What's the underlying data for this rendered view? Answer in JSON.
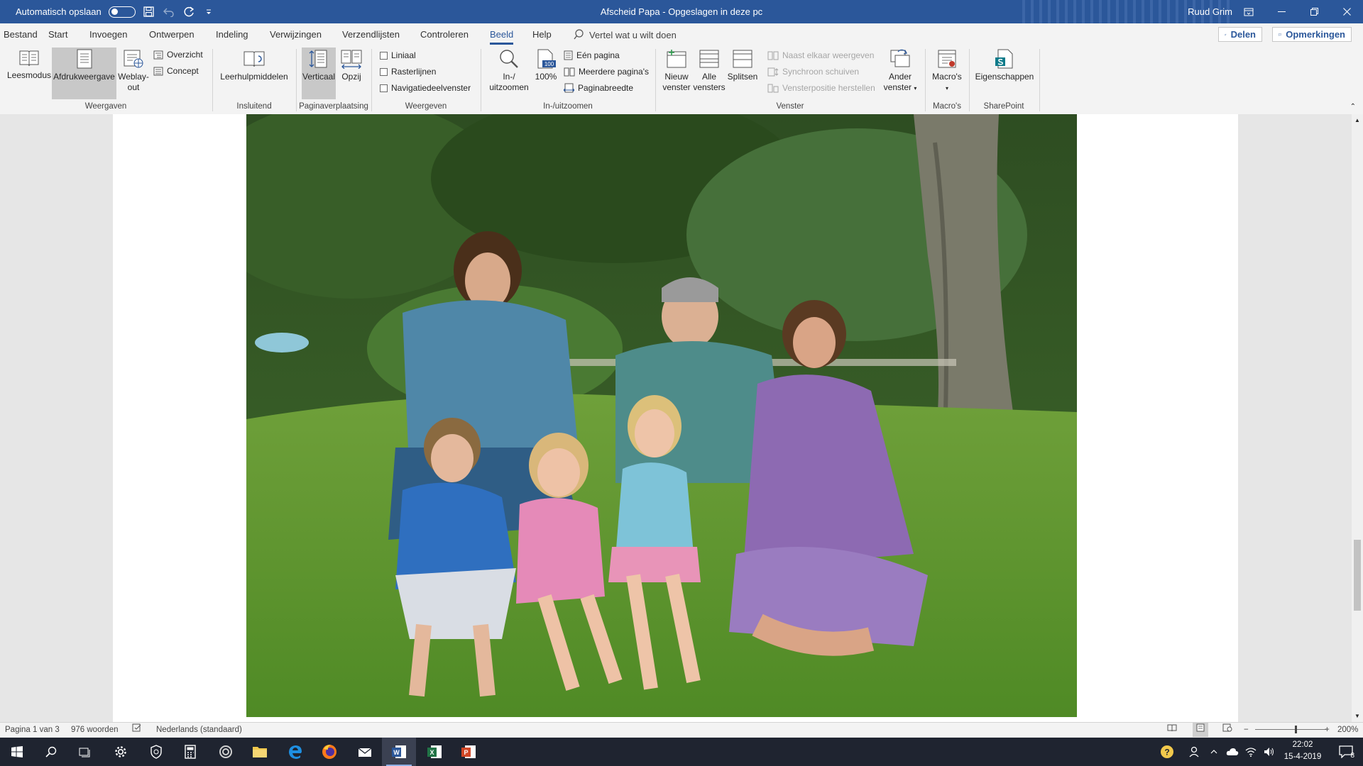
{
  "titlebar": {
    "autosave_label": "Automatisch opslaan",
    "doc_title": "Afscheid Papa - Opgeslagen in deze pc",
    "user_name": "Ruud Grim"
  },
  "tabs": [
    "Bestand",
    "Start",
    "Invoegen",
    "Ontwerpen",
    "Indeling",
    "Verwijzingen",
    "Verzendlijsten",
    "Controleren",
    "Beeld",
    "Help"
  ],
  "active_tab": "Beeld",
  "tellme": "Vertel wat u wilt doen",
  "share": {
    "delen": "Delen",
    "opmerkingen": "Opmerkingen"
  },
  "ribbon": {
    "weergaven": {
      "leesmodus": "Leesmodus",
      "afdrukweergave": "Afdrukweergave",
      "weblay_1": "Weblay-",
      "weblay_2": "out",
      "overzicht": "Overzicht",
      "concept": "Concept",
      "label": "Weergaven"
    },
    "insluitend": {
      "leerhulp": "Leerhulpmiddelen",
      "label": "Insluitend"
    },
    "paginaverplaatsing": {
      "verticaal": "Verticaal",
      "opzij": "Opzij",
      "label": "Paginaverplaatsing"
    },
    "weergeven": {
      "liniaal": "Liniaal",
      "rasterlijnen": "Rasterlijnen",
      "navigatie": "Navigatiedeelvenster",
      "label": "Weergeven"
    },
    "zoom": {
      "inuit_1": "In-/",
      "inuit_2": "uitzoomen",
      "honderd": "100%",
      "icon_100": "100",
      "een_pagina": "Eén pagina",
      "meerdere": "Meerdere pagina's",
      "paginabreedte": "Paginabreedte",
      "label": "In-/uitzoomen"
    },
    "venster": {
      "nieuw_1": "Nieuw",
      "nieuw_2": "venster",
      "alle_1": "Alle",
      "alle_2": "vensters",
      "splitsen": "Splitsen",
      "naast": "Naast elkaar weergeven",
      "synchroon": "Synchroon schuiven",
      "vensterpositie": "Vensterpositie herstellen",
      "ander_1": "Ander",
      "ander_2": "venster",
      "label": "Venster"
    },
    "macros": {
      "macros": "Macro's",
      "label": "Macro's"
    },
    "sharepoint": {
      "eigenschappen": "Eigenschappen",
      "label": "SharePoint"
    }
  },
  "statusbar": {
    "page": "Pagina 1 van 3",
    "words": "976 woorden",
    "language": "Nederlands (standaard)",
    "zoom": "200%"
  },
  "taskbar": {
    "time": "22:02",
    "date": "15-4-2019",
    "notifications": "8"
  },
  "colors": {
    "word_blue": "#2b579a",
    "ribbon_bg": "#f3f3f3",
    "taskbar_bg": "#1f2430"
  }
}
